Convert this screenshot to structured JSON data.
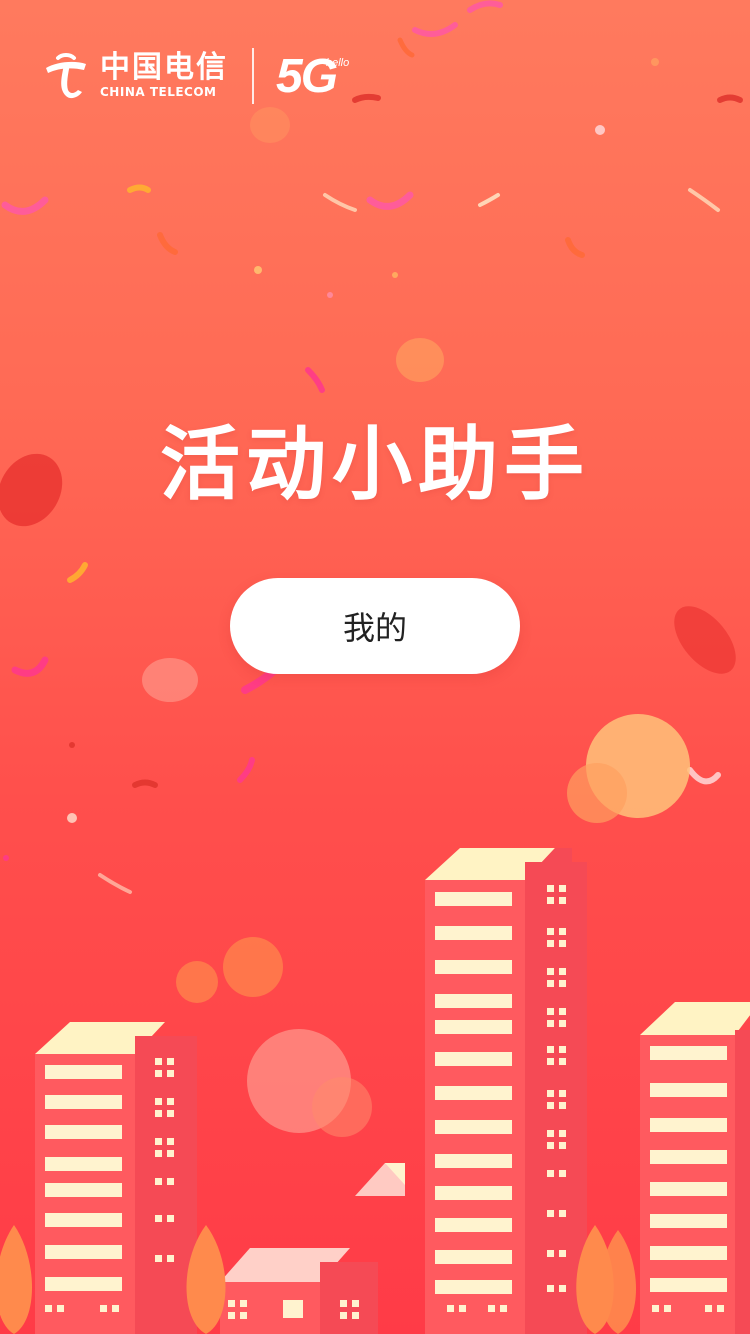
{
  "brand": {
    "logo_icon": "china-telecom-logo",
    "name_cn": "中国电信",
    "name_en": "CHINA TELECOM",
    "network": "5G",
    "network_tag": "hello"
  },
  "page": {
    "title": "活动小助手"
  },
  "actions": {
    "mine_label": "我的"
  },
  "colors": {
    "bg_top": "#ff7a5e",
    "bg_bottom": "#ff3b47",
    "building": "#ff5a5f",
    "building_shade": "#f54a55",
    "window": "#fff3cf",
    "roof": "#fff3c4",
    "tree": "#ff8a4c"
  }
}
